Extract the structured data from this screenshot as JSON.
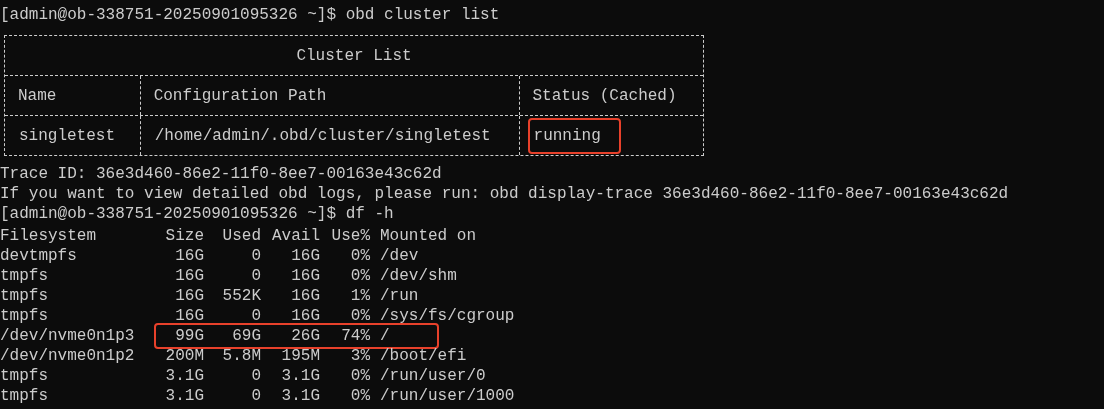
{
  "prompt_1": "[admin@ob-338751-20250901095326 ~]$ obd cluster list",
  "cluster_table": {
    "title": "Cluster List",
    "columns": [
      "Name",
      "Configuration Path",
      "Status (Cached)"
    ],
    "rows": [
      {
        "cells": [
          {
            "text": "singletest",
            "highlighted": false
          },
          {
            "text": "/home/admin/.obd/cluster/singletest",
            "highlighted": false
          },
          {
            "text": "running",
            "highlighted": true
          }
        ]
      }
    ]
  },
  "messages": [
    "Trace ID: 36e3d460-86e2-11f0-8ee7-00163e43c62d",
    "If you want to view detailed obd logs, please run: obd display-trace 36e3d460-86e2-11f0-8ee7-00163e43c62d"
  ],
  "prompt_2": "[admin@ob-338751-20250901095326 ~]$ df -h",
  "df_table": {
    "columns": [
      "Filesystem",
      "Size",
      "Used",
      "Avail",
      "Use%",
      "Mounted on"
    ],
    "rows": [
      {
        "cells": [
          "devtmpfs",
          "16G",
          "0",
          "16G",
          "0%",
          "/dev"
        ],
        "highlighted": false
      },
      {
        "cells": [
          "tmpfs",
          "16G",
          "0",
          "16G",
          "0%",
          "/dev/shm"
        ],
        "highlighted": false
      },
      {
        "cells": [
          "tmpfs",
          "16G",
          "552K",
          "16G",
          "1%",
          "/run"
        ],
        "highlighted": false
      },
      {
        "cells": [
          "tmpfs",
          "16G",
          "0",
          "16G",
          "0%",
          "/sys/fs/cgroup"
        ],
        "highlighted": false
      },
      {
        "cells": [
          "/dev/nvme0n1p3",
          "99G",
          "69G",
          "26G",
          "74%",
          "/"
        ],
        "highlighted": true
      },
      {
        "cells": [
          "/dev/nvme0n1p2",
          "200M",
          "5.8M",
          "195M",
          "3%",
          "/boot/efi"
        ],
        "highlighted": false
      },
      {
        "cells": [
          "tmpfs",
          "3.1G",
          "0",
          "3.1G",
          "0%",
          "/run/user/0"
        ],
        "highlighted": false
      },
      {
        "cells": [
          "tmpfs",
          "3.1G",
          "0",
          "3.1G",
          "0%",
          "/run/user/1000"
        ],
        "highlighted": false
      }
    ]
  }
}
